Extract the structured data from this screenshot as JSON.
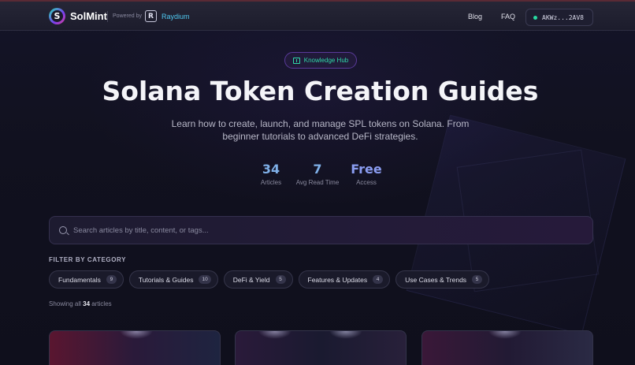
{
  "header": {
    "brand": "SolMint",
    "powered_by": "Powered by",
    "partner": "Raydium",
    "nav": [
      {
        "label": "Blog"
      },
      {
        "label": "FAQ"
      }
    ],
    "wallet_address": "AKWz...2AV8",
    "wallet_status_color": "#27d9a0"
  },
  "hero": {
    "badge": "Knowledge Hub",
    "title": "Solana Token Creation Guides",
    "subtitle": "Learn how to create, launch, and manage SPL tokens on Solana. From beginner tutorials to advanced DeFi strategies.",
    "stats": [
      {
        "value": "34",
        "label": "Articles",
        "color": "#7fb0e8"
      },
      {
        "value": "7",
        "label": "Avg Read Time",
        "color": "#7fb0e8"
      },
      {
        "value": "Free",
        "label": "Access",
        "color": "#7fb0e8"
      }
    ]
  },
  "search": {
    "placeholder": "Search articles by title, content, or tags..."
  },
  "filters": {
    "label": "FILTER BY CATEGORY",
    "categories": [
      {
        "label": "Fundamentals",
        "count": "9"
      },
      {
        "label": "Tutorials & Guides",
        "count": "10"
      },
      {
        "label": "DeFi & Yield",
        "count": "5"
      },
      {
        "label": "Features & Updates",
        "count": "4"
      },
      {
        "label": "Use Cases & Trends",
        "count": "5"
      }
    ]
  },
  "results": {
    "prefix": "Showing all",
    "count": "34",
    "suffix": "articles"
  },
  "colors": {
    "accent_green": "#2fd9a8",
    "accent_blue": "#4fc8f0",
    "background": "#0f0f1d"
  }
}
